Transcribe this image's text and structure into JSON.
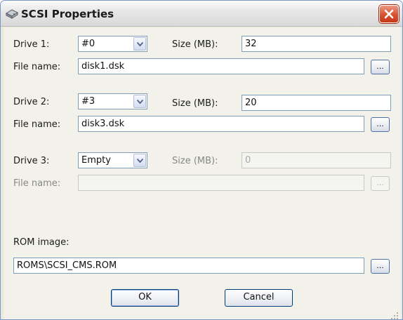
{
  "window": {
    "title": "SCSI Properties",
    "icon": "drive-icon",
    "close_glyph": "close-icon"
  },
  "drives": [
    {
      "drive_label": "Drive 1:",
      "drive_value": "#0",
      "size_label": "Size (MB):",
      "size_value": "32",
      "file_label": "File name:",
      "file_value": "disk1.dsk",
      "browse_label": "...",
      "enabled": true
    },
    {
      "drive_label": "Drive 2:",
      "drive_value": "#3",
      "size_label": "Size (MB):",
      "size_value": "20",
      "file_label": "File name:",
      "file_value": "disk3.dsk",
      "browse_label": "...",
      "enabled": true
    },
    {
      "drive_label": "Drive 3:",
      "drive_value": "Empty",
      "size_label": "Size (MB):",
      "size_value": "0",
      "file_label": "File name:",
      "file_value": "",
      "browse_label": "...",
      "enabled": false
    }
  ],
  "rom": {
    "label": "ROM image:",
    "value": "ROMS\\SCSI_CMS.ROM",
    "browse_label": "..."
  },
  "buttons": {
    "ok": "OK",
    "cancel": "Cancel"
  },
  "colors": {
    "close_button": "#d8502f",
    "field_border": "#7f9db9",
    "button_border": "#003c74",
    "dialog_background": "#f2f1ea"
  }
}
